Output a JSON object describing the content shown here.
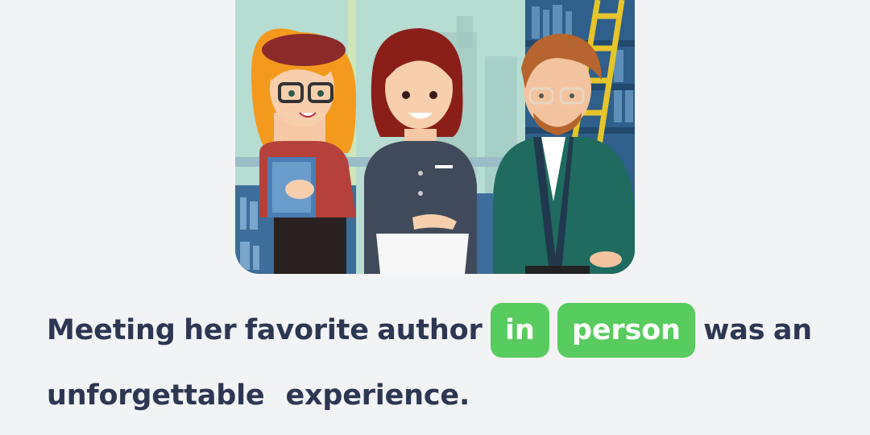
{
  "illustration": {
    "icon": "library-meeting-illustration",
    "colors": {
      "sky": "#aed8cc",
      "shelf": "#2f5f8a",
      "girl_hair": "#f39a1e",
      "beret": "#8a2a2a",
      "sweater": "#b6413b",
      "waitress_hair": "#8a1f1a",
      "uniform": "#3f4b5c",
      "man_cardigan": "#1f6b5f",
      "man_hair": "#b5652d"
    }
  },
  "sentence": {
    "words_line1": [
      "Meeting",
      "her",
      "favorite",
      "author"
    ],
    "chips": [
      "in",
      "person"
    ],
    "words_after_chips": [
      "was",
      "an"
    ],
    "words_line2": [
      "unforgettable",
      "experience."
    ],
    "chip_color": "#58cc5e",
    "text_color": "#2d3653"
  }
}
